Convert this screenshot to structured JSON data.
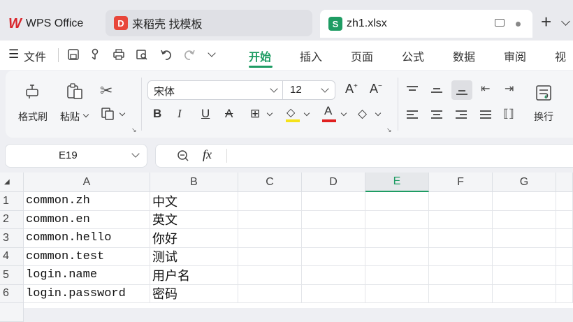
{
  "tabs": {
    "wps": "WPS Office",
    "docer": "来稻壳 找模板",
    "file": "zh1.xlsx",
    "file_badge": "S"
  },
  "menu": {
    "file": "文件",
    "items": [
      "开始",
      "插入",
      "页面",
      "公式",
      "数据",
      "审阅",
      "视"
    ]
  },
  "ribbon": {
    "format_painter": "格式刷",
    "paste": "粘贴",
    "font_name": "宋体",
    "font_size": "12",
    "wrap": "换行"
  },
  "formula": {
    "name_box": "E19",
    "fx": "fx",
    "value": ""
  },
  "sheet": {
    "columns": [
      "A",
      "B",
      "C",
      "D",
      "E",
      "F",
      "G"
    ],
    "rows": [
      {
        "n": "1",
        "a": "common.zh",
        "b": "中文"
      },
      {
        "n": "2",
        "a": "common.en",
        "b": "英文"
      },
      {
        "n": "3",
        "a": "common.hello",
        "b": "你好"
      },
      {
        "n": "4",
        "a": "common.test",
        "b": "测试"
      },
      {
        "n": "5",
        "a": "login.name",
        "b": "用户名"
      },
      {
        "n": "6",
        "a": "login.password",
        "b": "密码"
      }
    ]
  },
  "colors": {
    "accent": "#1e9c63",
    "wps_red": "#d9262c",
    "docer_red": "#e8463a"
  }
}
